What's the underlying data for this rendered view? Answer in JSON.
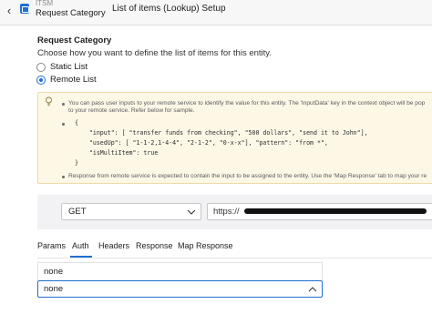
{
  "header": {
    "app_name": "ITSM",
    "app_sub": "Request Category",
    "page_title": "List of items (Lookup) Setup"
  },
  "section": {
    "title": "Request Category",
    "description": "Choose how you want to define the list of items for this entity.",
    "options": [
      {
        "label": "Static List",
        "selected": false
      },
      {
        "label": "Remote List",
        "selected": true
      }
    ]
  },
  "info": {
    "line1": "You can pass user inputs to your remote service to identify the value for this entity. The 'InputData' key in the context object will be pop",
    "line2": "to your remote service. Refer below for sample.",
    "code": [
      "{",
      "    \"input\": [ \"transfer funds from checking\", \"500 dollars\", \"send it to John\"],",
      "    \"usedUp\": [ \"1-1-2,1-4-4\", \"2-1-2\", \"0-x-x\"], \"pattern\": \"from *\",",
      "    \"isMultiItem\": true",
      "}"
    ],
    "line3": "Response from remote service is expected to contain the input to be assigned to the entity. Use the 'Map Response' tab to map your re"
  },
  "request": {
    "method": "GET",
    "url_prefix": "https://"
  },
  "tabs": [
    "Params",
    "Auth",
    "Headers",
    "Response",
    "Map Response"
  ],
  "active_tab": "Auth",
  "auth": {
    "list_option": "none",
    "selected": "none"
  },
  "colors": {
    "accent": "#1f6fd1",
    "info_bg": "#fdf7e6"
  }
}
